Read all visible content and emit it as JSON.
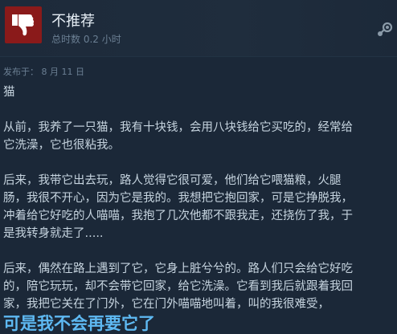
{
  "review": {
    "recommendation": "不推荐",
    "hours_on_record": "总时数 0.2 小时",
    "posted_date": "发布于： 8 月 11 日",
    "paragraphs": [
      "猫",
      "从前，我养了一只猫，我有十块钱，会用八块钱给它买吃的，经常给\n它洗澡，它也很粘我。",
      "后来，我带它出去玩，路人觉得它很可爱，他们给它喂猫粮，火腿\n肠，我很不开心，因为它是我的。我想把它抱回家，可是它挣脱我，\n冲着给它好吃的人喵喵，我抱了几次他都不跟我走，还挠伤了我，于\n是我转身就走了.....",
      "后来，偶然在路上遇到了它，它身上脏兮兮的。路人们只会给它好吃\n的，陪它玩玩，却不会带它回家，给它洗澡。它看到我后就跟着我回\n家，我把它关在了门外，它在门外喵喵地叫着，叫的我很难受，"
    ],
    "emphasis_line": "可是我不会再要它了"
  },
  "colors": {
    "background": "#1b2838",
    "thumb_down_bg": "#8a1a1a",
    "emphasis": "#5eb9f2"
  },
  "icons": {
    "recommendation_icon": "thumbs-down-icon",
    "corner_icon": "steam-logo-icon"
  }
}
